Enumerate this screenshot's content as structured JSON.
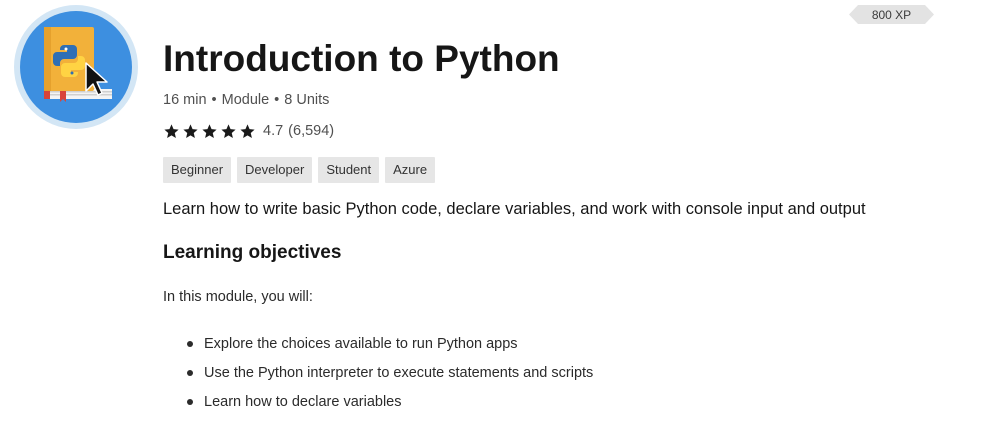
{
  "module": {
    "icon": "python-book-icon",
    "xp": "800 XP",
    "title": "Introduction to Python",
    "duration": "16 min",
    "type": "Module",
    "units": "8 Units",
    "separator": "•",
    "rating": {
      "stars": 5,
      "score": "4.7",
      "count": "(6,594)"
    },
    "tags": [
      "Beginner",
      "Developer",
      "Student",
      "Azure"
    ],
    "summary": "Learn how to write basic Python code, declare variables, and work with console input and output",
    "objectives_heading": "Learning objectives",
    "objectives_intro": "In this module, you will:",
    "objectives": [
      "Explore the choices available to run Python apps",
      "Use the Python interpreter to execute statements and scripts",
      "Learn how to declare variables"
    ]
  },
  "colors": {
    "icon_ring": "#d3e6f5",
    "icon_circle": "#3d8fe0",
    "book": "#f2b13a",
    "star": "#1a1a1a",
    "tag_bg": "#e6e6e6",
    "xp_bg": "#e3e3e3"
  }
}
